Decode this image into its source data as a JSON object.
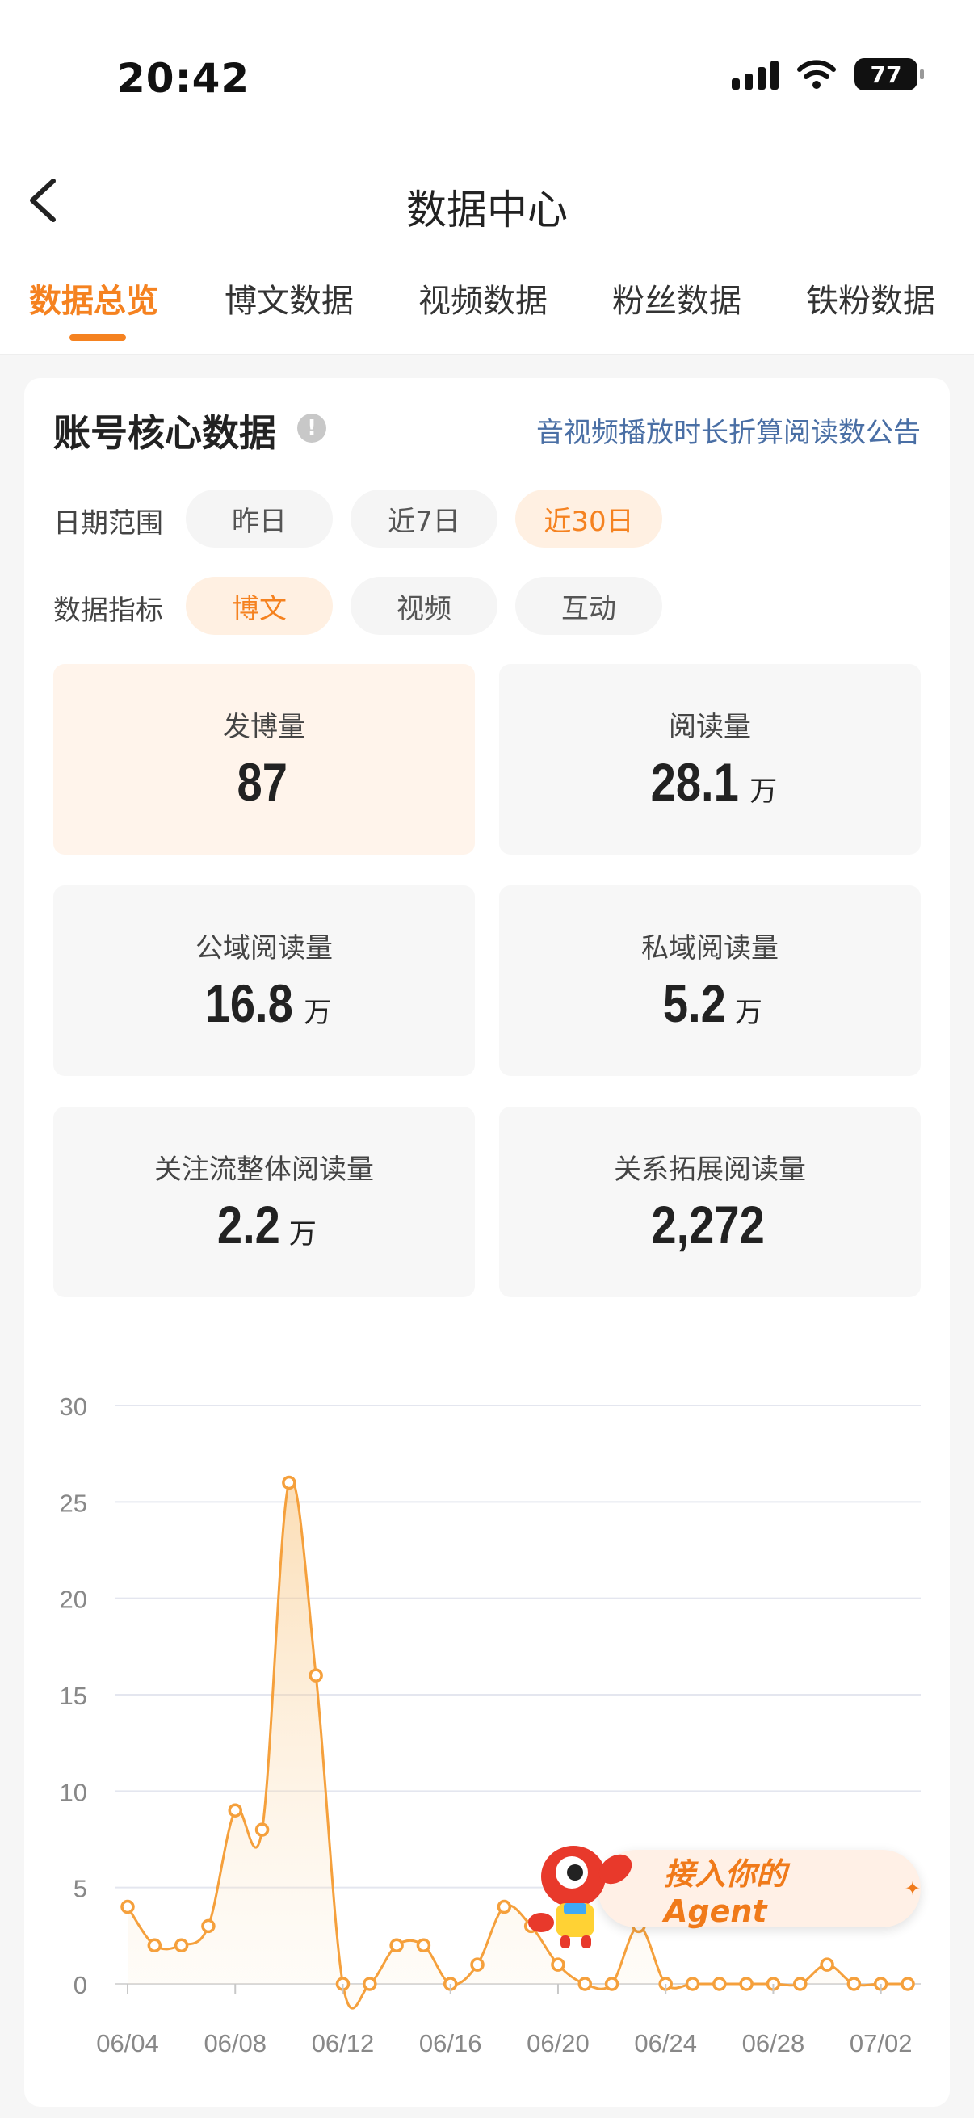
{
  "status_bar": {
    "time": "20:42",
    "battery": "77"
  },
  "header": {
    "title": "数据中心"
  },
  "tabs": [
    {
      "label": "数据总览",
      "active": true
    },
    {
      "label": "博文数据",
      "active": false
    },
    {
      "label": "视频数据",
      "active": false
    },
    {
      "label": "粉丝数据",
      "active": false
    },
    {
      "label": "铁粉数据",
      "active": false
    }
  ],
  "card": {
    "title": "账号核心数据",
    "info_icon": "!",
    "notice_link": "音视频播放时长折算阅读数公告",
    "date_range": {
      "label": "日期范围",
      "options": [
        {
          "label": "昨日",
          "active": false
        },
        {
          "label": "近7日",
          "active": false
        },
        {
          "label": "近30日",
          "active": true
        }
      ]
    },
    "metric": {
      "label": "数据指标",
      "options": [
        {
          "label": "博文",
          "active": true
        },
        {
          "label": "视频",
          "active": false
        },
        {
          "label": "互动",
          "active": false
        }
      ]
    },
    "stats": [
      {
        "label": "发博量",
        "value": "87",
        "unit": "",
        "highlight": true
      },
      {
        "label": "阅读量",
        "value": "28.1",
        "unit": "万",
        "highlight": false
      },
      {
        "label": "公域阅读量",
        "value": "16.8",
        "unit": "万",
        "highlight": false
      },
      {
        "label": "私域阅读量",
        "value": "5.2",
        "unit": "万",
        "highlight": false
      },
      {
        "label": "关注流整体阅读量",
        "value": "2.2",
        "unit": "万",
        "highlight": false
      },
      {
        "label": "关系拓展阅读量",
        "value": "2,272",
        "unit": "",
        "highlight": false
      }
    ]
  },
  "chart_data": {
    "type": "area",
    "title": "",
    "xlabel": "",
    "ylabel": "",
    "ylim": [
      0,
      30
    ],
    "yticks": [
      "0",
      "5",
      "10",
      "15",
      "20",
      "25",
      "30"
    ],
    "xtick_labels": [
      "06/04",
      "06/08",
      "06/12",
      "06/16",
      "06/20",
      "06/24",
      "06/28",
      "07/02"
    ],
    "x": [
      "06/04",
      "06/05",
      "06/06",
      "06/07",
      "06/08",
      "06/09",
      "06/10",
      "06/11",
      "06/12",
      "06/13",
      "06/14",
      "06/15",
      "06/16",
      "06/17",
      "06/18",
      "06/19",
      "06/20",
      "06/21",
      "06/22",
      "06/23",
      "06/24",
      "06/25",
      "06/26",
      "06/27",
      "06/28",
      "06/29",
      "06/30",
      "07/01",
      "07/02",
      "07/03"
    ],
    "series": [
      {
        "values": [
          4,
          2,
          2,
          3,
          9,
          8,
          26,
          16,
          0,
          0,
          2,
          2,
          0,
          1,
          4,
          3,
          1,
          0,
          0,
          3,
          0,
          0,
          0,
          0,
          0,
          0,
          1,
          0,
          0,
          0
        ]
      }
    ],
    "grid": true,
    "color": "#f5a03c"
  },
  "agent_button": {
    "label": "接入你的 Agent"
  }
}
